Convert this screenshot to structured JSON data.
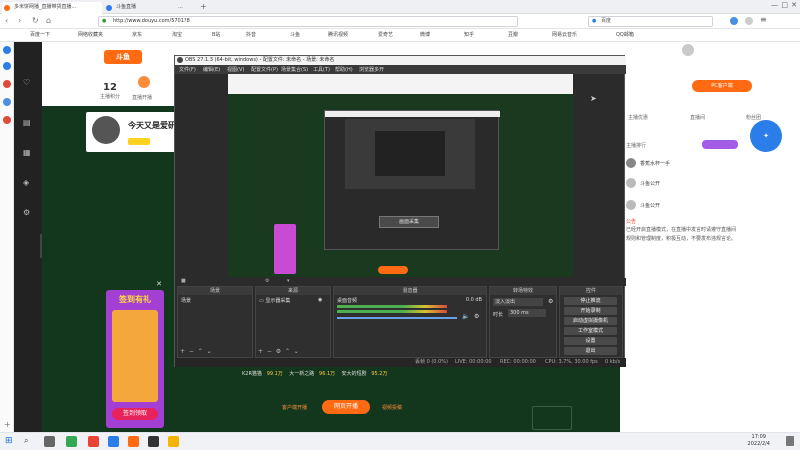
{
  "browser": {
    "tabs": [
      {
        "label": "多米饼网播_直播带货直播..."
      },
      {
        "label": "斗鱼直播"
      },
      {
        "label": "..."
      }
    ],
    "url": "http://www.douyu.com/5701?8",
    "search_placeholder": "百度",
    "bookmarks": [
      "百度一下",
      "网络收藏夹",
      "京东",
      "淘宝",
      "B站",
      "抖音",
      "斗鱼",
      "腾讯视频",
      "爱奇艺",
      "微博",
      "知乎",
      "豆瓣",
      "网易云音乐",
      "QQ邮箱"
    ]
  },
  "douyu": {
    "logo": "斗鱼",
    "stats": [
      {
        "value": "12",
        "label": "主播积分"
      },
      {
        "value": "",
        "label": "直播开播"
      }
    ],
    "streamer_title": "今天又是爱研",
    "promo": {
      "title": "签到有礼",
      "button": "签到领取"
    },
    "bottom_items": [
      "K2R猫猫",
      "99.1万",
      "大一新之路",
      "96.1万",
      "安大的短剧",
      "95.2万"
    ],
    "bottom_buttons": [
      "客户端开播",
      "网页开播",
      "视频投稿"
    ],
    "pc_button": "PC客户端",
    "right_panel": {
      "tabs": [
        "主播优惠",
        "直播间",
        "粉丝团"
      ],
      "rank_label": "主播排行",
      "users": [
        "香蕉水杯一手",
        "斗鱼公开",
        "斗鱼公开"
      ],
      "notice_label": "公告",
      "notice_text": "已经开启直播模式，在直播中发言时请遵守直播间规则和管理制度，积极互动，不要发布违规言论。"
    }
  },
  "obs": {
    "title": "OBS 27.1.3 (64-bit, windows) - 配置文件: 未命名 - 场景: 未命名",
    "menu": [
      "文件(F)",
      "编辑(E)",
      "视图(V)",
      "配置文件(P)",
      "场景集合(S)",
      "工具(T)",
      "帮助(H)",
      "浏览器多开"
    ],
    "preview_text": "画面采集",
    "docks": {
      "scenes": {
        "title": "场景",
        "items": [
          "场景"
        ]
      },
      "sources": {
        "title": "来源",
        "items": [
          "显示器采集"
        ]
      },
      "mixer": {
        "title": "混音器",
        "track": "桌面音频",
        "level": "0.0 dB"
      },
      "transitions": {
        "title": "转场特效",
        "type": "淡入淡出",
        "duration_label": "时长",
        "duration": "300 ms"
      },
      "controls": {
        "title": "控件",
        "buttons": [
          "停止推流",
          "开始录制",
          "启动虚拟摄像机",
          "工作室模式",
          "设置",
          "退出"
        ]
      }
    },
    "status": {
      "live": "LIVE: 00:00:00",
      "rec": "REC: 00:00:00",
      "cpu": "CPU: 3.7%, 30.00 fps",
      "dropped": "丢帧 0 (0.0%)",
      "kbps": "0 kb/s"
    }
  },
  "taskbar": {
    "time": "17:09",
    "date": "2022/2/4"
  },
  "colors": {
    "douyu_orange": "#ff6a13",
    "obs_bg": "#2b2b2b",
    "dark_green": "#13371d",
    "accent_blue": "#2b7de9"
  }
}
